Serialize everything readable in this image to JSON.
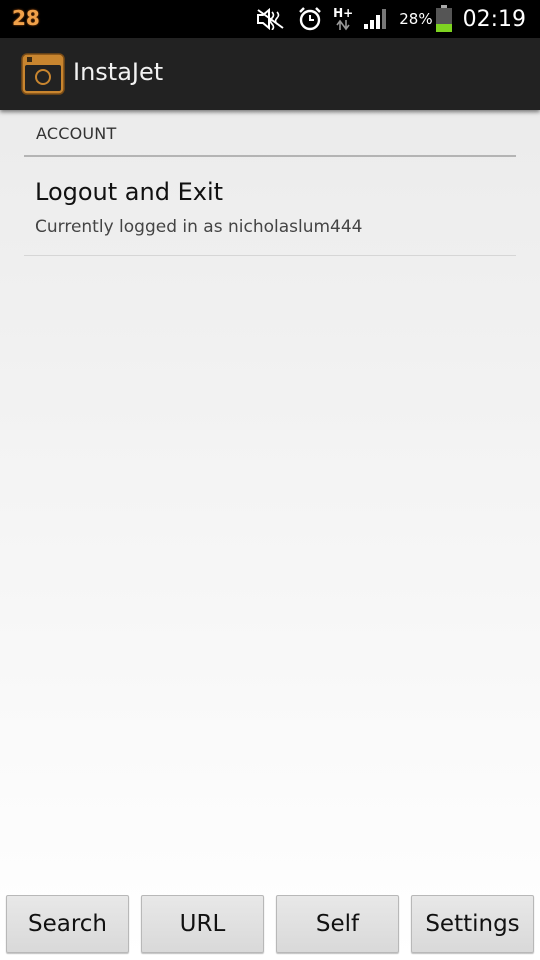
{
  "status_bar": {
    "notification_count": "28",
    "network_type": "H+",
    "battery_percent": "28%",
    "time": "02:19",
    "icons": [
      "mute-icon",
      "alarm-icon",
      "data-arrows-icon",
      "signal-icon",
      "battery-icon"
    ]
  },
  "action_bar": {
    "title": "InstaJet",
    "icon": "camera-icon",
    "accent_color": "#c8852f"
  },
  "preferences": {
    "section_header": "ACCOUNT",
    "items": [
      {
        "title": "Logout and Exit",
        "summary": "Currently logged in as nicholaslum444"
      }
    ]
  },
  "bottom_buttons": {
    "search": "Search",
    "url": "URL",
    "self": "Self",
    "settings": "Settings"
  }
}
